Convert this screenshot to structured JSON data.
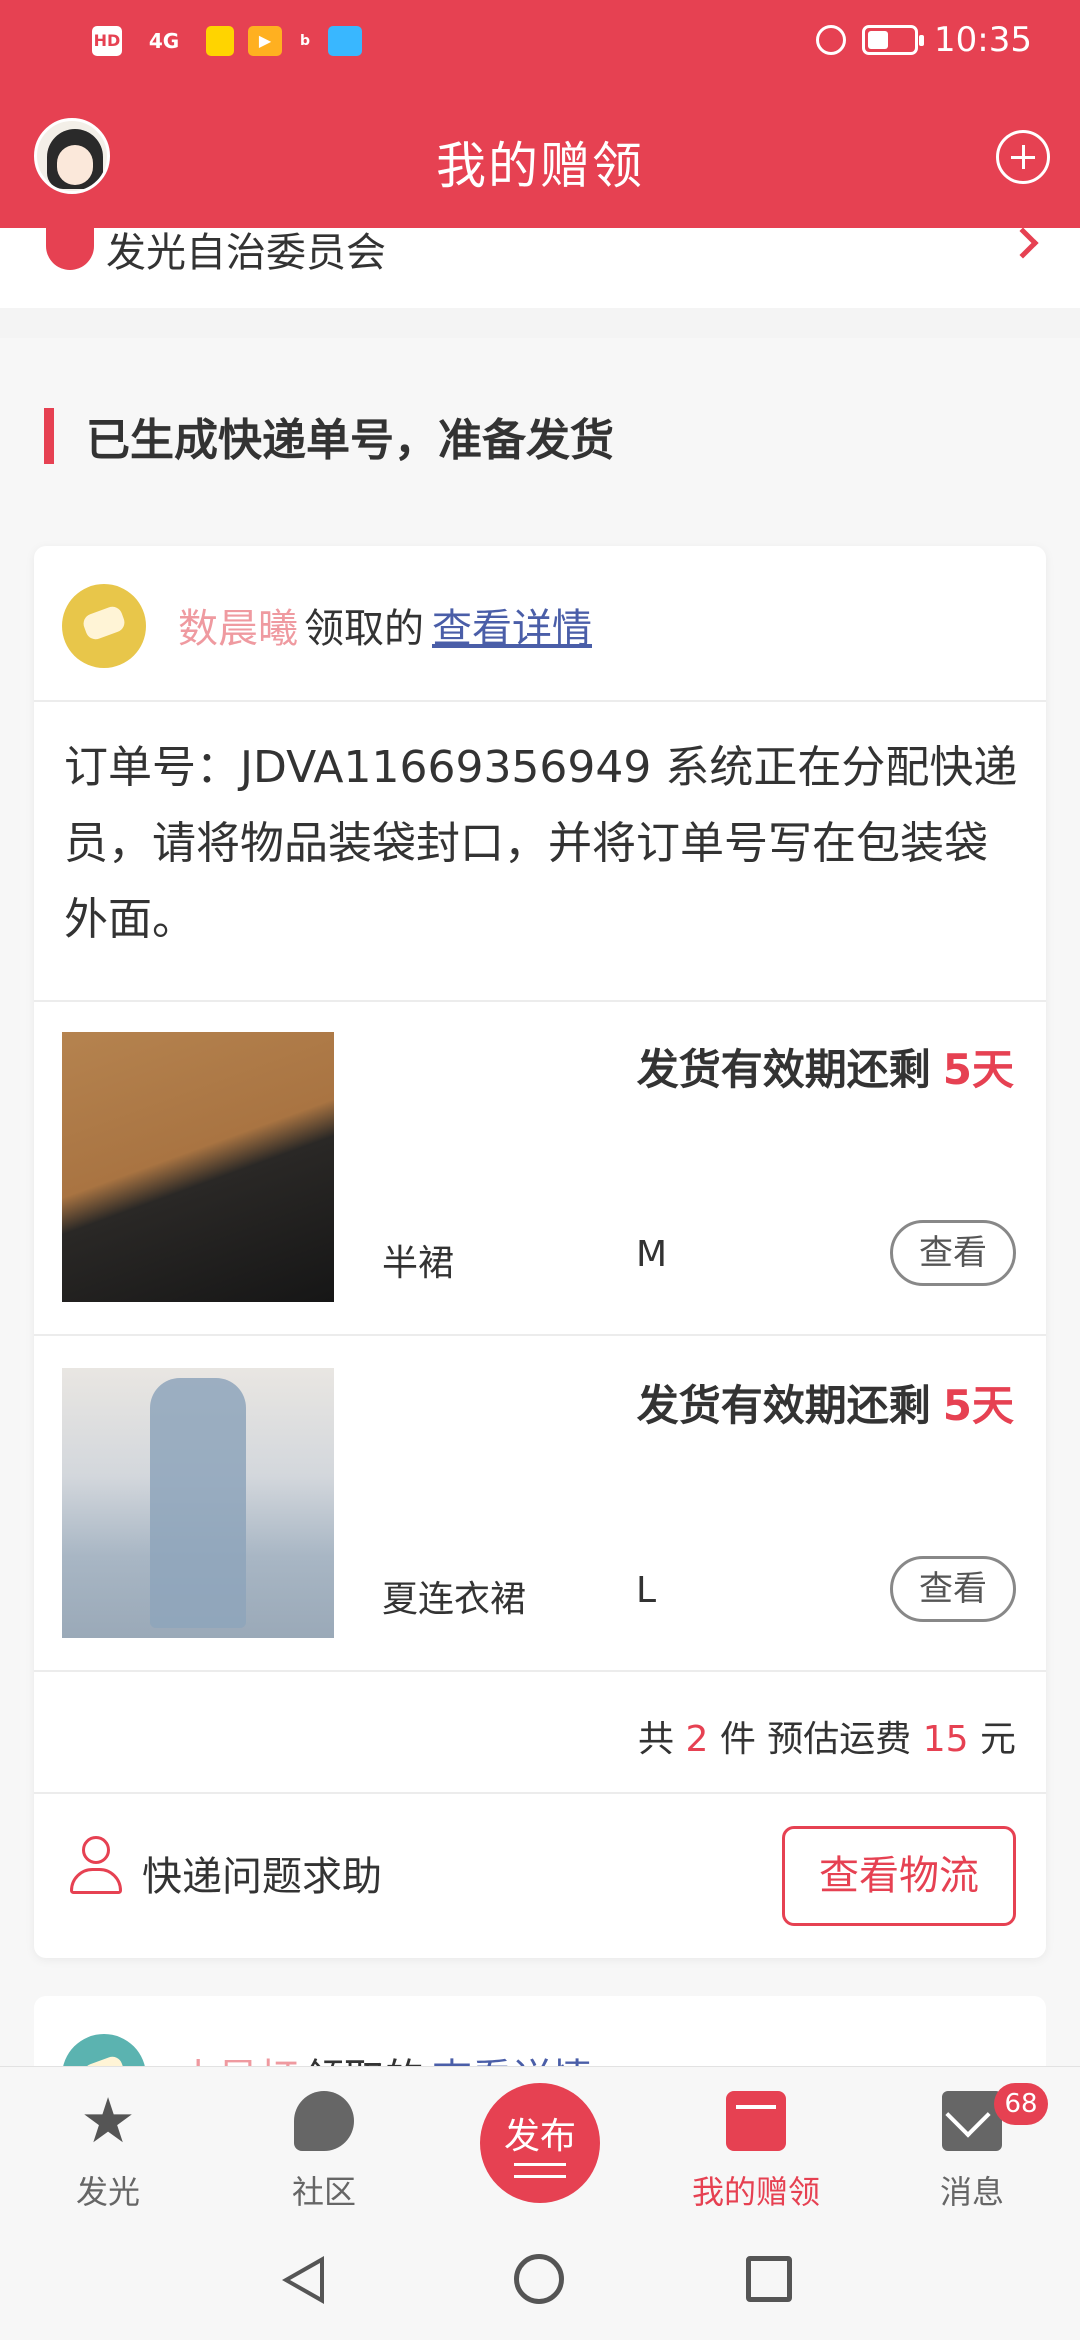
{
  "status_bar": {
    "time": "10:35",
    "hd_label": "HD",
    "signal_label": "4G",
    "battery_level": 0.45
  },
  "header": {
    "title": "我的赠领"
  },
  "committee": {
    "label": "发光自治委员会"
  },
  "section": {
    "title": "已生成快递单号，准备发货"
  },
  "order_card": {
    "username": "数晨曦",
    "claimed_text": "领取的",
    "detail_link": "查看详情",
    "order_text": "订单号：JDVA11669356949 系统正在分配快递员，请将物品装袋封口，并将订单号写在包装袋外面。",
    "items": [
      {
        "deadline_label": "发货有效期还剩",
        "days": "5天",
        "name": "半裙",
        "size": "M",
        "view_label": "查看"
      },
      {
        "deadline_label": "发货有效期还剩",
        "days": "5天",
        "name": "夏连衣裙",
        "size": "L",
        "view_label": "查看"
      }
    ],
    "summary": {
      "prefix": "共",
      "count": "2",
      "unit": "件 预估运费",
      "fee": "15",
      "currency": "元"
    },
    "help_label": "快递问题求助",
    "logistics_button": "查看物流"
  },
  "next_card": {
    "username": "小星灯",
    "claimed_text": "领取的",
    "detail_link": "查看详情"
  },
  "tabbar": {
    "tabs": [
      {
        "label": "发光",
        "icon": "star-icon"
      },
      {
        "label": "社区",
        "icon": "chat-icon"
      },
      {
        "label": "发布",
        "icon": "publish-icon"
      },
      {
        "label": "我的赠领",
        "icon": "book-icon"
      },
      {
        "label": "消息",
        "icon": "mail-icon"
      }
    ],
    "message_badge": "68"
  },
  "colors": {
    "brand_red": "#e64152",
    "link_blue": "#4a5ea8",
    "username_pink": "#ef9aa0"
  }
}
